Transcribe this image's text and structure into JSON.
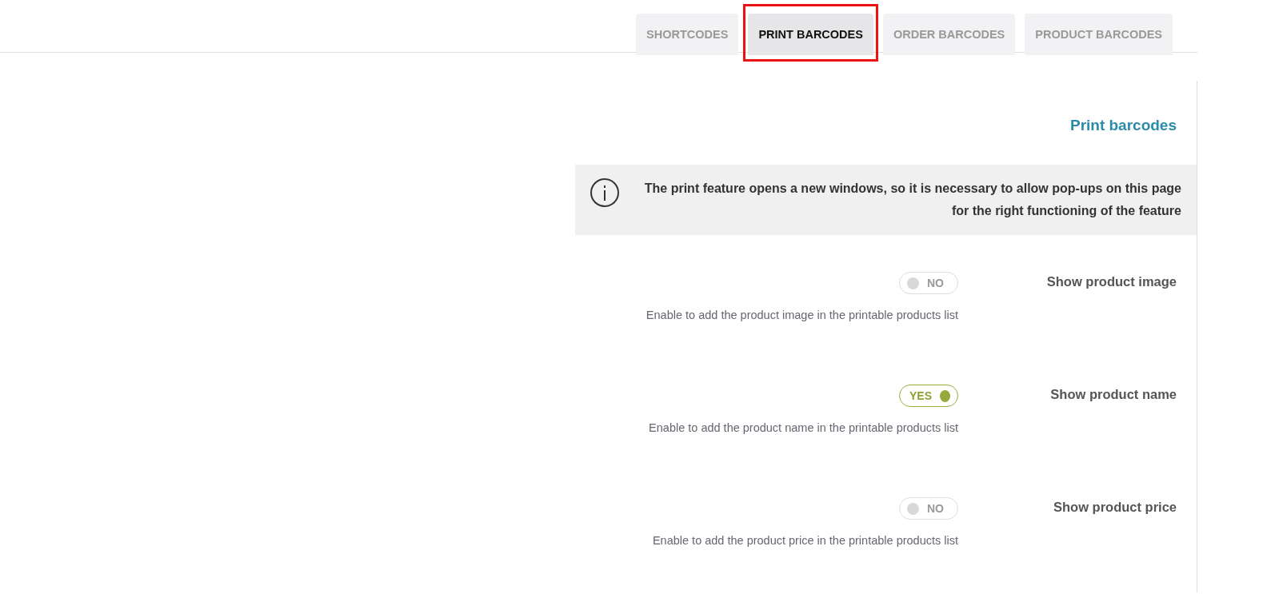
{
  "tabs": [
    {
      "label": "SHORTCODES",
      "selected": false,
      "highlighted": false
    },
    {
      "label": "PRINT BARCODES",
      "selected": true,
      "highlighted": true
    },
    {
      "label": "ORDER BARCODES",
      "selected": false,
      "highlighted": false
    },
    {
      "label": "PRODUCT BARCODES",
      "selected": false,
      "highlighted": false
    }
  ],
  "panel": {
    "title": "Print barcodes",
    "notice": "The print feature opens a new windows, so it is necessary to allow pop-ups on this page for the right functioning of the feature",
    "options": [
      {
        "label": "Show product image",
        "on": false,
        "toggle_text": "NO",
        "description": "Enable to add the product image in the printable products list"
      },
      {
        "label": "Show product name",
        "on": true,
        "toggle_text": "YES",
        "description": "Enable to add the product name in the printable products list"
      },
      {
        "label": "Show product price",
        "on": false,
        "toggle_text": "NO",
        "description": "Enable to add the product price in the printable products list"
      }
    ]
  }
}
